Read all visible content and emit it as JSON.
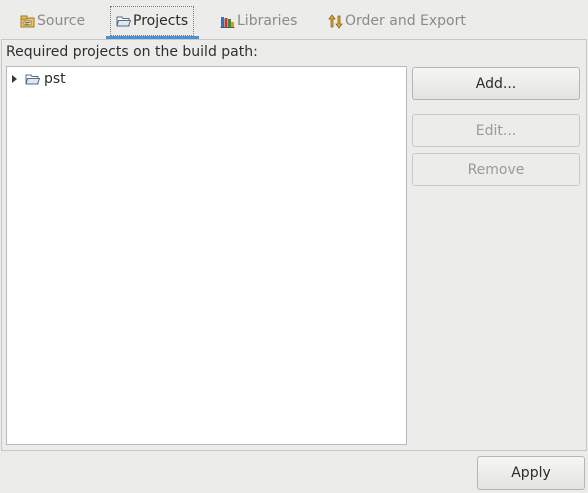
{
  "tabs": [
    {
      "label": "Source",
      "icon": "source-folder-icon",
      "active": false
    },
    {
      "label": "Projects",
      "icon": "open-folder-icon",
      "active": true
    },
    {
      "label": "Libraries",
      "icon": "libraries-icon",
      "active": false
    },
    {
      "label": "Order and Export",
      "icon": "order-export-icon",
      "active": false
    }
  ],
  "projects_panel": {
    "label": "Required projects on the build path:",
    "tree": [
      {
        "label": "pst",
        "icon": "project-folder-icon",
        "expanded": false
      }
    ]
  },
  "buttons": {
    "add": "Add...",
    "edit": "Edit...",
    "remove": "Remove"
  },
  "footer": {
    "apply": "Apply"
  },
  "colors": {
    "accent": "#4a90d9",
    "background": "#ececeb",
    "disabled_text": "#9a9a9a"
  }
}
